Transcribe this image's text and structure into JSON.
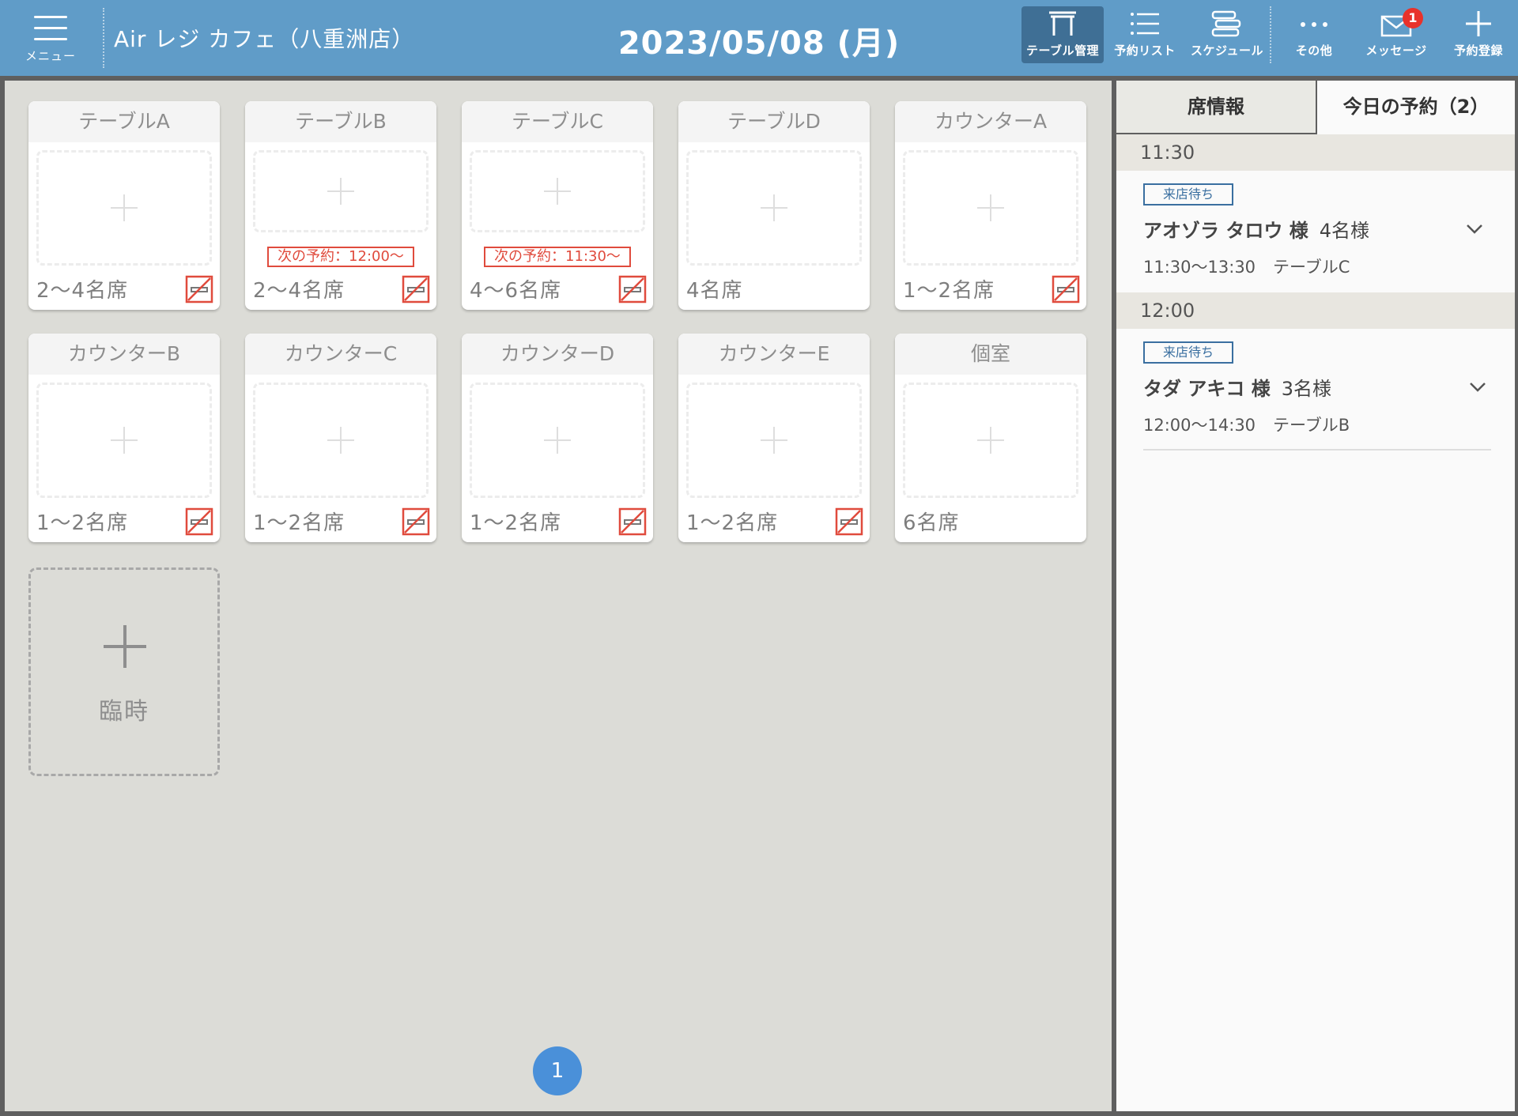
{
  "header": {
    "menu_label": "メニュー",
    "store_name": "Air レジ カフェ（八重洲店）",
    "date": "2023/05/08 (月)",
    "nav": [
      {
        "label": "テーブル管理",
        "icon": "table-icon"
      },
      {
        "label": "予約リスト",
        "icon": "list-icon"
      },
      {
        "label": "スケジュール",
        "icon": "schedule-icon"
      },
      {
        "label": "その他",
        "icon": "more-icon"
      },
      {
        "label": "メッセージ",
        "icon": "mail-icon",
        "badge": "1"
      },
      {
        "label": "予約登録",
        "icon": "plus-icon"
      }
    ]
  },
  "tables": [
    {
      "name": "テーブルA",
      "capacity": "2〜4名席",
      "no_smoking": true,
      "next": ""
    },
    {
      "name": "テーブルB",
      "capacity": "2〜4名席",
      "no_smoking": true,
      "next": "次の予約：12:00〜"
    },
    {
      "name": "テーブルC",
      "capacity": "4〜6名席",
      "no_smoking": true,
      "next": "次の予約：11:30〜"
    },
    {
      "name": "テーブルD",
      "capacity": "4名席",
      "no_smoking": false,
      "next": ""
    },
    {
      "name": "カウンターA",
      "capacity": "1〜2名席",
      "no_smoking": true,
      "next": ""
    },
    {
      "name": "カウンターB",
      "capacity": "1〜2名席",
      "no_smoking": true,
      "next": ""
    },
    {
      "name": "カウンターC",
      "capacity": "1〜2名席",
      "no_smoking": true,
      "next": ""
    },
    {
      "name": "カウンターD",
      "capacity": "1〜2名席",
      "no_smoking": true,
      "next": ""
    },
    {
      "name": "カウンターE",
      "capacity": "1〜2名席",
      "no_smoking": true,
      "next": ""
    },
    {
      "name": "個室",
      "capacity": "6名席",
      "no_smoking": false,
      "next": ""
    }
  ],
  "temp_table": {
    "label": "臨時"
  },
  "pagination": {
    "current_page": "1"
  },
  "side": {
    "tabs": [
      {
        "label": "席情報",
        "active": false
      },
      {
        "label": "今日の予約（2）",
        "active": true
      }
    ],
    "reservations": [
      {
        "time": "11:30",
        "status": "来店待ち",
        "name": "アオゾラ タロウ 様",
        "people": "4名様",
        "range": "11:30〜13:30",
        "table": "テーブルC"
      },
      {
        "time": "12:00",
        "status": "来店待ち",
        "name": "タダ アキコ 様",
        "people": "3名様",
        "range": "12:00〜14:30",
        "table": "テーブルB"
      }
    ]
  },
  "colors": {
    "header_bg": "#609cc8",
    "active_nav": "#3f6f95",
    "alert_red": "#e04b3d",
    "status_blue": "#3a6fa0",
    "page_dot": "#4a90d9"
  }
}
